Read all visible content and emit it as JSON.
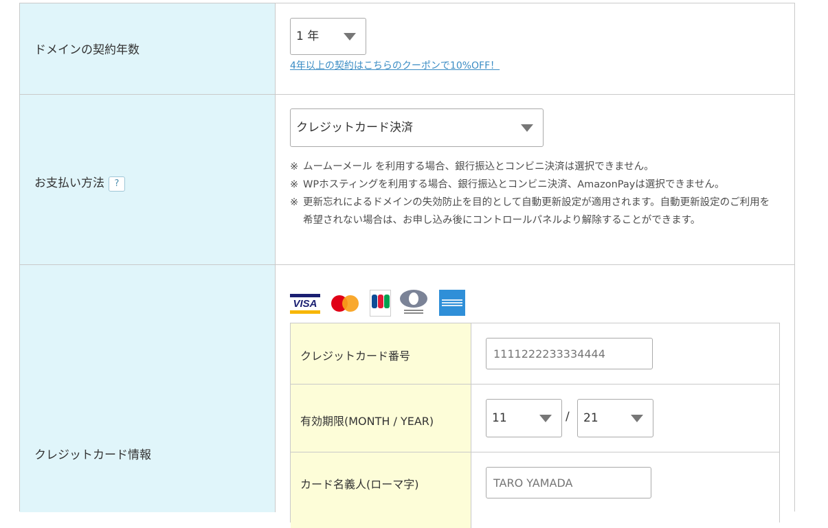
{
  "rows": {
    "contract_years": {
      "label": "ドメインの契約年数",
      "selected": "1 年",
      "coupon_link": "4年以上の契約はこちらのクーポンで10%OFF！"
    },
    "payment": {
      "label": "お支払い方法",
      "help": "?",
      "selected": "クレジットカード決済",
      "notes": [
        "ムームーメール を利用する場合、銀行振込とコンビニ決済は選択できません。",
        "WPホスティングを利用する場合、銀行振込とコンビニ決済、AmazonPayは選択できません。",
        "更新忘れによるドメインの失効防止を目的として自動更新設定が適用されます。自動更新設定のご利用を希望されない場合は、お申し込み後にコントロールパネルより解除することができます。"
      ],
      "note_mark": "※"
    },
    "credit_card": {
      "label": "クレジットカード情報",
      "card_brands": [
        "visa-logo",
        "mastercard-logo",
        "jcb-logo",
        "diners-club-logo",
        "american-express-logo"
      ],
      "visa_text": "VISA",
      "fields": {
        "number": {
          "label": "クレジットカード番号",
          "placeholder": "1111222233334444"
        },
        "expiry": {
          "label": "有効期限(MONTH / YEAR)",
          "month": "11",
          "year": "21",
          "separator": "/"
        },
        "holder": {
          "label": "カード名義人(ローマ字)",
          "placeholder": "TARO YAMADA"
        }
      }
    }
  },
  "colors": {
    "label_bg": "#e0f5fa",
    "inner_label_bg": "#fdfdd8",
    "border": "#c9c9c9",
    "link": "#3a8cc4"
  }
}
